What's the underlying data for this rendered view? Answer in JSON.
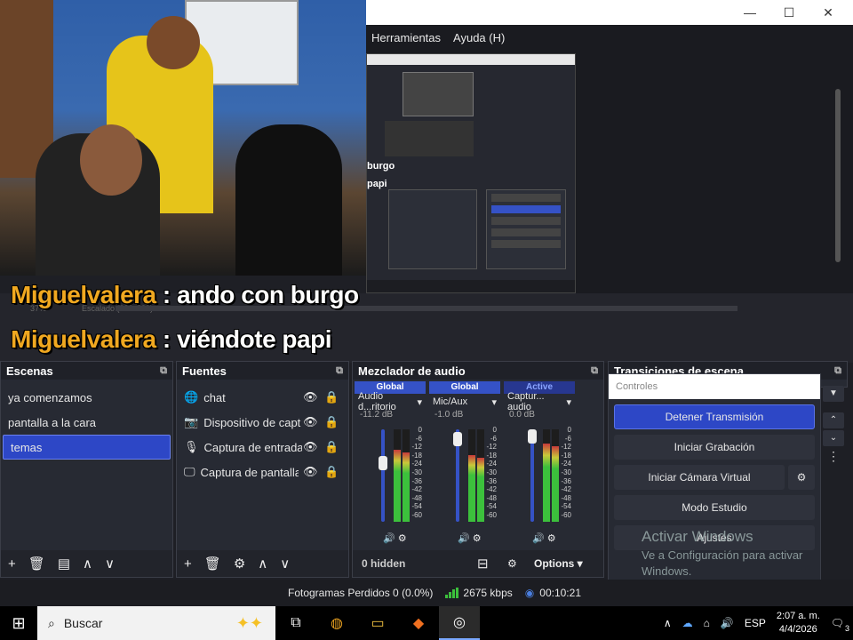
{
  "window": {
    "minimize_glyph": "—",
    "maximize_glyph": "☐",
    "close_glyph": "✕",
    "menu": [
      "Herramientas",
      "Ayuda (H)"
    ]
  },
  "nested_preview": {
    "label_burgo": "burgo",
    "label_papi": "papi"
  },
  "strip": {
    "zoom": "37%",
    "scale_label": "Escalado (386x289)"
  },
  "chat_overlay": [
    {
      "user": "Miguelvalera",
      "message": ": ando con burgo"
    },
    {
      "user": "Miguelvalera",
      "message": ": viéndote papi"
    }
  ],
  "scenes": {
    "title": "Escenas",
    "items": [
      "ya comenzamos",
      "pantalla a la cara",
      "temas"
    ],
    "selected": "temas"
  },
  "sources": {
    "title": "Fuentes",
    "items": [
      {
        "icon": "globe-icon",
        "glyph": "🌐",
        "name": "chat"
      },
      {
        "icon": "camera-icon",
        "glyph": "📷",
        "name": "Dispositivo de capt"
      },
      {
        "icon": "microphone-icon",
        "glyph": "🎙",
        "name": "Captura de entrada"
      },
      {
        "icon": "monitor-icon",
        "glyph": "🖵",
        "name": "Captura de pantalla"
      }
    ]
  },
  "mixer": {
    "title": "Mezclador de audio",
    "channels": [
      {
        "tab": "Global",
        "name": "Audio d...ritorio",
        "db": "-11.2 dB",
        "level": 0.78,
        "volume": 0.66
      },
      {
        "tab": "Global",
        "name": "Mic/Aux",
        "db": "-1.0 dB",
        "level": 0.72,
        "volume": 0.97
      },
      {
        "tab": "Active",
        "name": "Captur... audio",
        "db": "0.0 dB",
        "level": 0.85,
        "volume": 1.0
      }
    ],
    "scale": [
      "0",
      "-6",
      "-12",
      "-18",
      "-24",
      "-30",
      "-36",
      "-42",
      "-48",
      "-54",
      "-60"
    ],
    "hidden_label": "0 hidden",
    "options_label": "Options"
  },
  "transitions": {
    "title": "Transiciones de escena"
  },
  "controls": {
    "title": "Controles",
    "buttons": [
      "Detener Transmisión",
      "Iniciar Grabación",
      "Iniciar Cámara Virtual",
      "Modo Estudio",
      "Ajustes"
    ],
    "watermark_title": "Activar Windows",
    "watermark_body": "Ve a Configuración para activar Windows."
  },
  "status": {
    "dropped_frames": "Fotogramas Perdidos 0 (0.0%)",
    "bitrate": "2675 kbps",
    "time": "00:10:21"
  },
  "taskbar": {
    "search_placeholder": "Buscar",
    "language": "ESP",
    "time": "2:07 a. m.",
    "date": "4/4/2026",
    "notification_count": "3"
  },
  "colors": {
    "accent": "#2d47c6",
    "chat_user": "#f0a820",
    "meter_green": "#3cc03c"
  }
}
